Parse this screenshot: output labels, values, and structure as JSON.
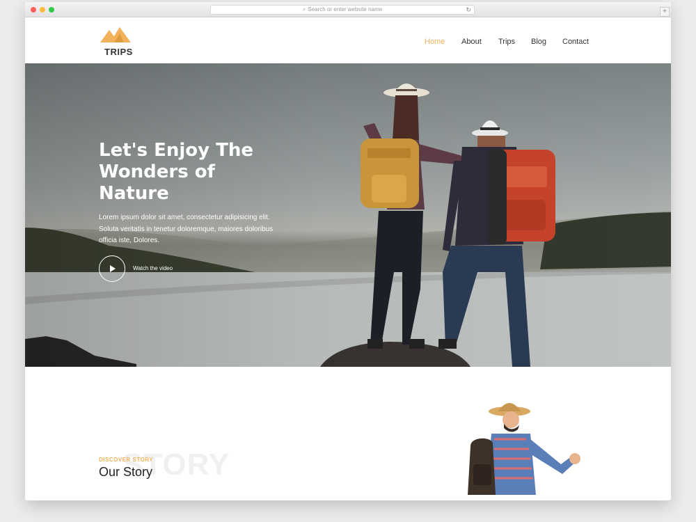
{
  "browser": {
    "address_placeholder": "Search or enter website name",
    "new_tab": "+"
  },
  "brand": {
    "name": "TRIPS",
    "accent": "#f2b25c"
  },
  "nav": {
    "items": [
      {
        "label": "Home",
        "active": true
      },
      {
        "label": "About",
        "active": false
      },
      {
        "label": "Trips",
        "active": false
      },
      {
        "label": "Blog",
        "active": false
      },
      {
        "label": "Contact",
        "active": false
      }
    ]
  },
  "hero": {
    "title_lines": [
      "Let's Enjoy The",
      "Wonders of",
      "Nature"
    ],
    "text_lines": [
      "Lorem ipsum dolor sit amet, consectetur adipisicing elit.",
      "Soluta veritatis in tenetur doloremque, maiores doloribus",
      "officia iste, Dolores."
    ],
    "video_label": "Watch the video"
  },
  "story": {
    "background_word": "STORY",
    "eyebrow": "DISCOVER STORY",
    "title": "Our Story"
  }
}
